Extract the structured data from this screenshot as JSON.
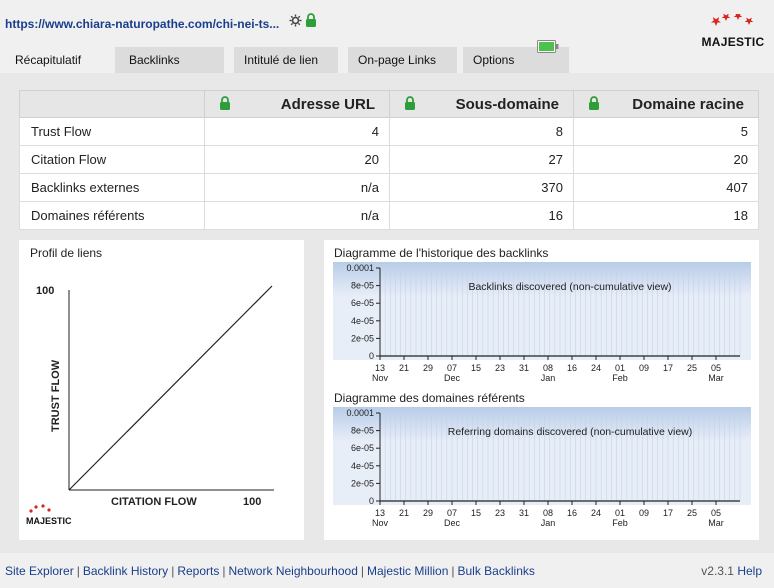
{
  "header": {
    "url": "https://www.chiara-naturopathe.com/chi-nei-ts...",
    "settings_icon": "gear-icon",
    "lock_icon": "lock-icon",
    "logo_text": "MAJESTIC"
  },
  "tabs": [
    {
      "label": "Récapitulatif",
      "active": true
    },
    {
      "label": "Backlinks",
      "active": false
    },
    {
      "label": "Intitulé de lien",
      "active": false
    },
    {
      "label": "On-page Links",
      "active": false
    },
    {
      "label": "Options",
      "active": false
    }
  ],
  "summary": {
    "headers": [
      "",
      "Adresse URL",
      "Sous-domaine",
      "Domaine racine"
    ],
    "rows": [
      {
        "label": "Trust Flow",
        "values": [
          "4",
          "8",
          "5"
        ]
      },
      {
        "label": "Citation Flow",
        "values": [
          "20",
          "27",
          "20"
        ]
      },
      {
        "label": "Backlinks externes",
        "values": [
          "n/a",
          "370",
          "407"
        ]
      },
      {
        "label": "Domaines référents",
        "values": [
          "n/a",
          "16",
          "18"
        ]
      }
    ]
  },
  "link_profile": {
    "title": "Profil de liens",
    "y_label": "TRUST FLOW",
    "x_label": "CITATION FLOW",
    "y_max_label": "100",
    "x_max_label": "100",
    "logo_text": "MAJESTIC"
  },
  "charts": {
    "backlinks_title": "Diagramme de l'historique des backlinks",
    "domains_title": "Diagramme des domaines référents"
  },
  "chart_data": [
    {
      "type": "area",
      "title": "Backlinks discovered (non-cumulative view)",
      "y_ticks": [
        "0.0001",
        "8e-05",
        "6e-05",
        "4e-05",
        "2e-05",
        "0"
      ],
      "ylim": [
        0,
        0.0001
      ],
      "x_ticks": [
        "13",
        "21",
        "29",
        "07",
        "15",
        "23",
        "31",
        "08",
        "16",
        "24",
        "01",
        "09",
        "17",
        "25",
        "05"
      ],
      "x_month_labels": [
        {
          "at": "13",
          "label": "Nov"
        },
        {
          "at": "07",
          "label": "Dec"
        },
        {
          "at": "08",
          "label": "Jan"
        },
        {
          "at": "01",
          "label": "Feb"
        },
        {
          "at": "05",
          "label": "Mar"
        }
      ],
      "values": []
    },
    {
      "type": "area",
      "title": "Referring domains discovered (non-cumulative view)",
      "y_ticks": [
        "0.0001",
        "8e-05",
        "6e-05",
        "4e-05",
        "2e-05",
        "0"
      ],
      "ylim": [
        0,
        0.0001
      ],
      "x_ticks": [
        "13",
        "21",
        "29",
        "07",
        "15",
        "23",
        "31",
        "08",
        "16",
        "24",
        "01",
        "09",
        "17",
        "25",
        "05"
      ],
      "x_month_labels": [
        {
          "at": "13",
          "label": "Nov"
        },
        {
          "at": "07",
          "label": "Dec"
        },
        {
          "at": "08",
          "label": "Jan"
        },
        {
          "at": "01",
          "label": "Feb"
        },
        {
          "at": "05",
          "label": "Mar"
        }
      ],
      "values": []
    }
  ],
  "footer": {
    "links": [
      "Site Explorer",
      "Backlink History",
      "Reports",
      "Network Neighbourhood",
      "Majestic Million",
      "Bulk Backlinks"
    ],
    "version": "v2.3.1",
    "help": "Help"
  },
  "colors": {
    "link": "#1a3e8c",
    "lock_green": "#2e9e3a",
    "battery_green": "#4cc24c",
    "chart_bg": "#e8eef8",
    "chart_top": "#b8cce8"
  }
}
